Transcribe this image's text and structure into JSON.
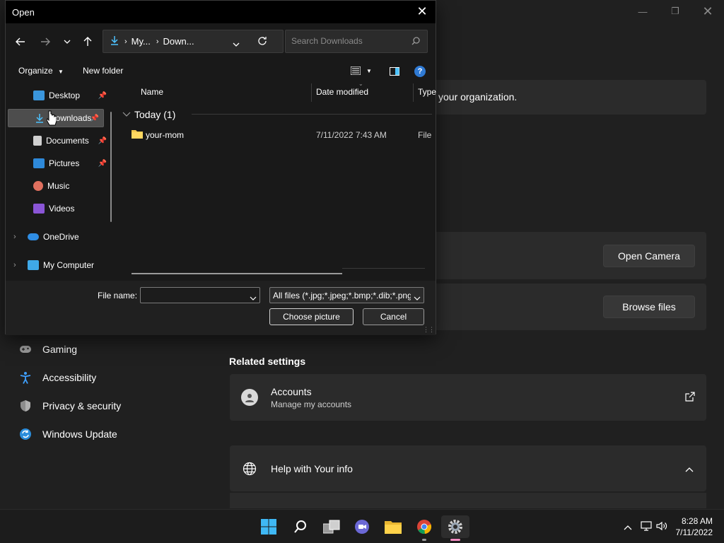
{
  "settings": {
    "org_text": "your organization.",
    "open_camera_label": "Open Camera",
    "browse_files_label": "Browse files",
    "related_settings_heading": "Related settings",
    "accounts_title": "Accounts",
    "accounts_subtitle": "Manage my accounts",
    "help_title": "Help with Your info",
    "nav_items": [
      {
        "label": "Gaming",
        "icon": "gamepad-icon"
      },
      {
        "label": "Accessibility",
        "icon": "accessibility-icon"
      },
      {
        "label": "Privacy & security",
        "icon": "shield-icon"
      },
      {
        "label": "Windows Update",
        "icon": "update-icon"
      }
    ]
  },
  "dialog": {
    "title": "Open",
    "breadcrumb": [
      "My...",
      "Down..."
    ],
    "search_placeholder": "Search Downloads",
    "organize_label": "Organize",
    "new_folder_label": "New folder",
    "sidebar": [
      {
        "label": "Desktop",
        "pinned": true,
        "icon": "desktop-icon"
      },
      {
        "label": "Downloads",
        "pinned": true,
        "selected": true,
        "icon": "download-icon"
      },
      {
        "label": "Documents",
        "pinned": true,
        "icon": "documents-icon"
      },
      {
        "label": "Pictures",
        "pinned": true,
        "icon": "pictures-icon"
      },
      {
        "label": "Music",
        "pinned": false,
        "icon": "music-icon"
      },
      {
        "label": "Videos",
        "pinned": false,
        "icon": "videos-icon"
      },
      {
        "label": "OneDrive",
        "pinned": false,
        "icon": "cloud-icon"
      },
      {
        "label": "My Computer",
        "pinned": false,
        "icon": "computer-icon"
      }
    ],
    "columns": [
      "Name",
      "Date modified",
      "Type"
    ],
    "group_label": "Today (1)",
    "files": [
      {
        "name": "your-mom",
        "date_modified": "7/11/2022 7:43 AM",
        "type": "File fo"
      }
    ],
    "file_name_label": "File name:",
    "file_name_value": "",
    "filter_value": "All files (*.jpg;*.jpeg;*.bmp;*.dib;*.png",
    "choose_label": "Choose picture",
    "cancel_label": "Cancel"
  },
  "taskbar": {
    "time": "8:28 AM",
    "date": "7/11/2022",
    "apps": [
      "windows-start-icon",
      "search-icon",
      "task-view-icon",
      "teams-chat-icon",
      "file-explorer-icon",
      "chrome-icon",
      "settings-icon"
    ]
  },
  "colors": {
    "accent": "#4cc2ff",
    "folder": "#f4c84f",
    "selection": "#4d4d4d"
  }
}
